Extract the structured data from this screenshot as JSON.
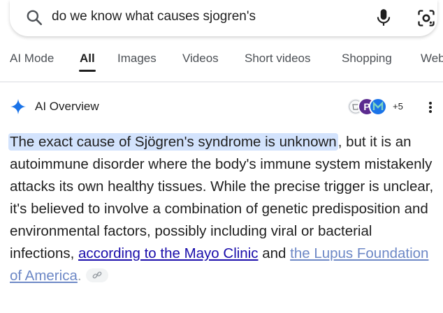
{
  "search": {
    "query": "do we know what causes sjogren's"
  },
  "tabs": [
    {
      "label": "AI Mode"
    },
    {
      "label": "All"
    },
    {
      "label": "Images"
    },
    {
      "label": "Videos"
    },
    {
      "label": "Short videos"
    },
    {
      "label": "Shopping"
    },
    {
      "label": "Web"
    }
  ],
  "active_tab": "All",
  "ai_overview": {
    "title": "AI Overview",
    "sources_more": "+5",
    "source_p_letter": "P",
    "highlight": "The exact cause of Sjögren's syndrome is unknown",
    "body_1": ", but it is an autoimmune disorder where the body's immune system mistakenly attacks its own healthy tissues. While the precise trigger is unclear, it's believed to involve a combination of genetic predisposition and environmental factors, possibly including viral or bacterial infections, ",
    "link_1": "according to the Mayo Clinic",
    "and_text": " and ",
    "link_2": "the Lupus Foundation of America",
    "end_text": "."
  },
  "colors": {
    "accent": "#1a73e8",
    "highlight": "#d3e3fd",
    "link": "#1a0dab"
  },
  "icons": [
    "search-icon",
    "mic-icon",
    "lens-icon",
    "sparkle-icon",
    "more-vert-icon",
    "link-icon"
  ]
}
